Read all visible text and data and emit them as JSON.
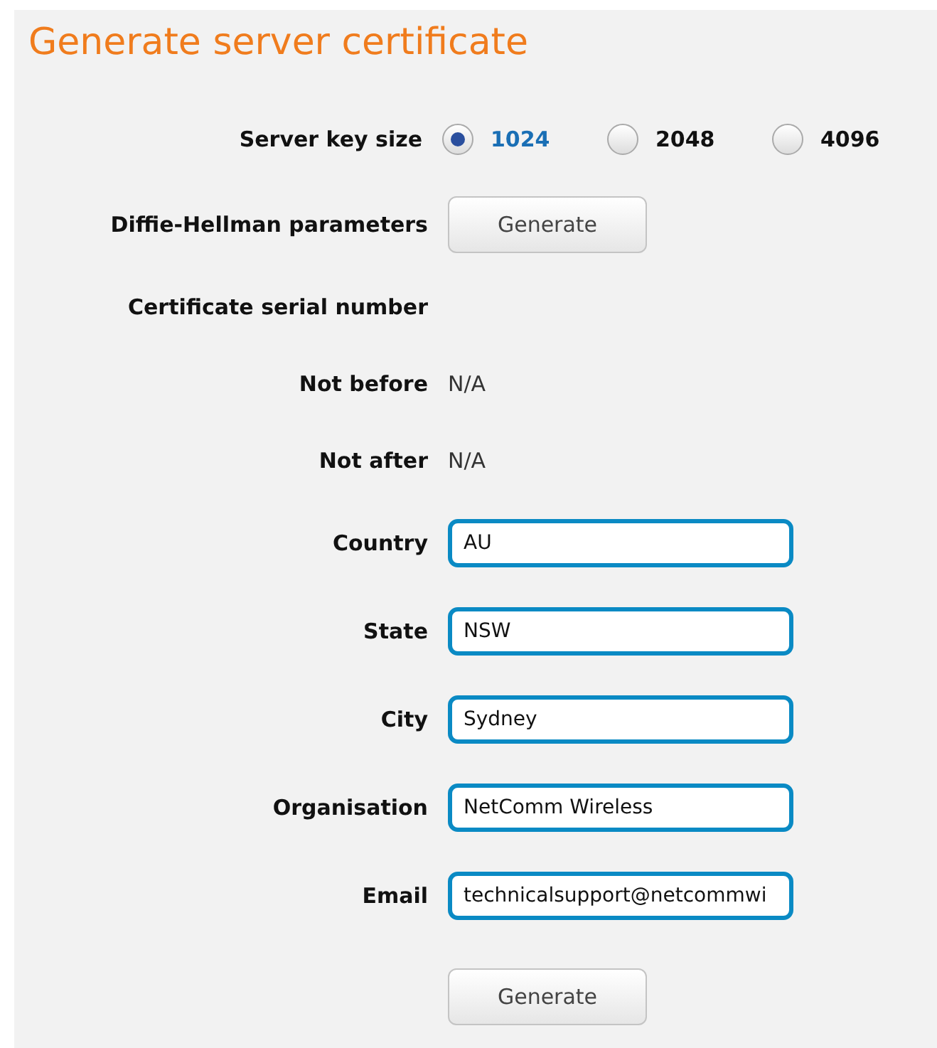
{
  "title": "Generate server certificate",
  "rows": [
    {
      "kind": "radio",
      "label": "Server key size",
      "options": [
        {
          "label": "1024",
          "selected": true
        },
        {
          "label": "2048",
          "selected": false
        },
        {
          "label": "4096",
          "selected": false
        }
      ]
    },
    {
      "kind": "button",
      "label": "Diffie-Hellman parameters",
      "button": "Generate"
    },
    {
      "kind": "text",
      "label": "Certificate serial number"
    },
    {
      "kind": "text",
      "label": "Not before",
      "value": "N/A"
    },
    {
      "kind": "text",
      "label": "Not after",
      "value": "N/A"
    },
    {
      "kind": "field",
      "label": "Country",
      "value": "AU"
    },
    {
      "kind": "field",
      "label": "State",
      "value": "NSW"
    },
    {
      "kind": "field",
      "label": "City",
      "value": "Sydney"
    },
    {
      "kind": "field",
      "label": "Organisation",
      "value": "NetComm Wireless"
    },
    {
      "kind": "field",
      "label": "Email",
      "value": "technicalsupport@netcommwi"
    }
  ],
  "submit_button": "Generate"
}
